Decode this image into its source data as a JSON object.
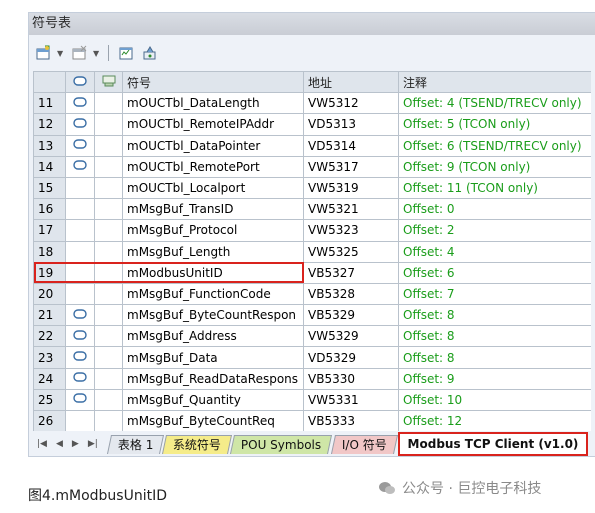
{
  "panel": {
    "title": "符号表"
  },
  "columns": {
    "symbol": "符号",
    "address": "地址",
    "comment": "注释"
  },
  "rows": [
    {
      "num": "11",
      "icon": true,
      "symbol": "mOUCTbl_DataLength",
      "address": "VW5312",
      "comment": "Offset: 4 (TSEND/TRECV only)"
    },
    {
      "num": "12",
      "icon": true,
      "symbol": "mOUCTbl_RemoteIPAddr",
      "address": "VD5313",
      "comment": "Offset: 5 (TCON only)"
    },
    {
      "num": "13",
      "icon": true,
      "symbol": "mOUCTbl_DataPointer",
      "address": "VD5314",
      "comment": "Offset: 6 (TSEND/TRECV only)"
    },
    {
      "num": "14",
      "icon": true,
      "symbol": "mOUCTbl_RemotePort",
      "address": "VW5317",
      "comment": "Offset: 9 (TCON only)"
    },
    {
      "num": "15",
      "icon": false,
      "symbol": "mOUCTbl_Localport",
      "address": "VW5319",
      "comment": "Offset: 11 (TCON only)"
    },
    {
      "num": "16",
      "icon": false,
      "symbol": "mMsgBuf_TransID",
      "address": "VW5321",
      "comment": "Offset: 0"
    },
    {
      "num": "17",
      "icon": false,
      "symbol": "mMsgBuf_Protocol",
      "address": "VW5323",
      "comment": "Offset: 2"
    },
    {
      "num": "18",
      "icon": false,
      "symbol": "mMsgBuf_Length",
      "address": "VW5325",
      "comment": "Offset: 4"
    },
    {
      "num": "19",
      "icon": false,
      "symbol": "mModbusUnitID",
      "address": "VB5327",
      "comment": "Offset: 6"
    },
    {
      "num": "20",
      "icon": false,
      "symbol": "mMsgBuf_FunctionCode",
      "address": "VB5328",
      "comment": "Offset: 7"
    },
    {
      "num": "21",
      "icon": true,
      "symbol": "mMsgBuf_ByteCountRespon",
      "address": "VB5329",
      "comment": "Offset: 8"
    },
    {
      "num": "22",
      "icon": true,
      "symbol": "mMsgBuf_Address",
      "address": "VW5329",
      "comment": "Offset: 8"
    },
    {
      "num": "23",
      "icon": true,
      "symbol": "mMsgBuf_Data",
      "address": "VD5329",
      "comment": "Offset: 8"
    },
    {
      "num": "24",
      "icon": true,
      "symbol": "mMsgBuf_ReadDataRespons",
      "address": "VB5330",
      "comment": "Offset: 9"
    },
    {
      "num": "25",
      "icon": true,
      "symbol": "mMsgBuf_Quantity",
      "address": "VW5331",
      "comment": "Offset: 10"
    },
    {
      "num": "26",
      "icon": false,
      "symbol": "mMsgBuf_ByteCountReq",
      "address": "VB5333",
      "comment": "Offset: 12"
    }
  ],
  "tabs": [
    {
      "label": "表格 1"
    },
    {
      "label": "系统符号"
    },
    {
      "label": "POU Symbols"
    },
    {
      "label": "I/O 符号"
    },
    {
      "label": "Modbus TCP Client (v1.0)"
    }
  ],
  "caption": "图4.mModbusUnitID",
  "watermark": "公众号 · 巨控电子科技",
  "colors": {
    "comment_text": "#1a9d1a",
    "highlight": "#d9231d"
  }
}
